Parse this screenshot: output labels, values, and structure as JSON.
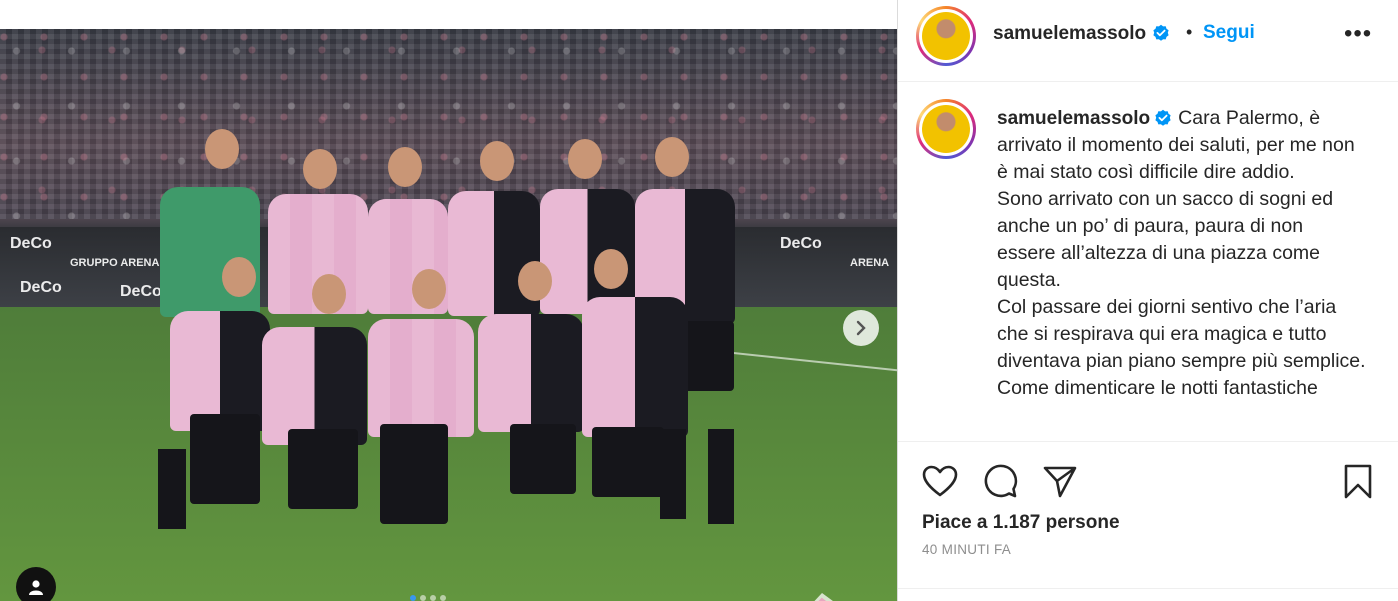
{
  "post": {
    "username": "samuelemassolo",
    "separator": "•",
    "follow_label": "Segui",
    "more_label": "•••",
    "caption_lines": [
      "Cara Palermo, è arrivato il momento dei saluti, per me non è mai stato così difficile dire addio.",
      "Sono arrivato con un sacco di sogni ed anche un po’ di paura, paura di non essere all’altezza di una piazza come questa.",
      "Col passare dei giorni sentivo che l’aria che si respirava qui era magica e tutto diventava pian piano sempre più semplice.",
      "Come dimenticare le notti fantastiche"
    ],
    "likes_text": "Piace a 1.187 persone",
    "time_text": "40 MINUTI FA"
  },
  "media": {
    "ad_text": [
      "DeCo",
      "GRUPPO ARENA",
      "DeCo",
      "DeCo",
      "DeCo",
      "ARENA"
    ],
    "carousel_active_index": 0,
    "carousel_count": 4
  },
  "icons": {
    "like": "heart-icon",
    "comment": "comment-icon",
    "share": "send-icon",
    "save": "bookmark-icon",
    "next": "chevron-right-icon",
    "tag": "user-tag-icon",
    "verified": "verified-badge-icon"
  },
  "colors": {
    "accent": "#0095f6",
    "text": "#262626",
    "muted": "#8e8e8e",
    "verified": "#0095f6"
  }
}
